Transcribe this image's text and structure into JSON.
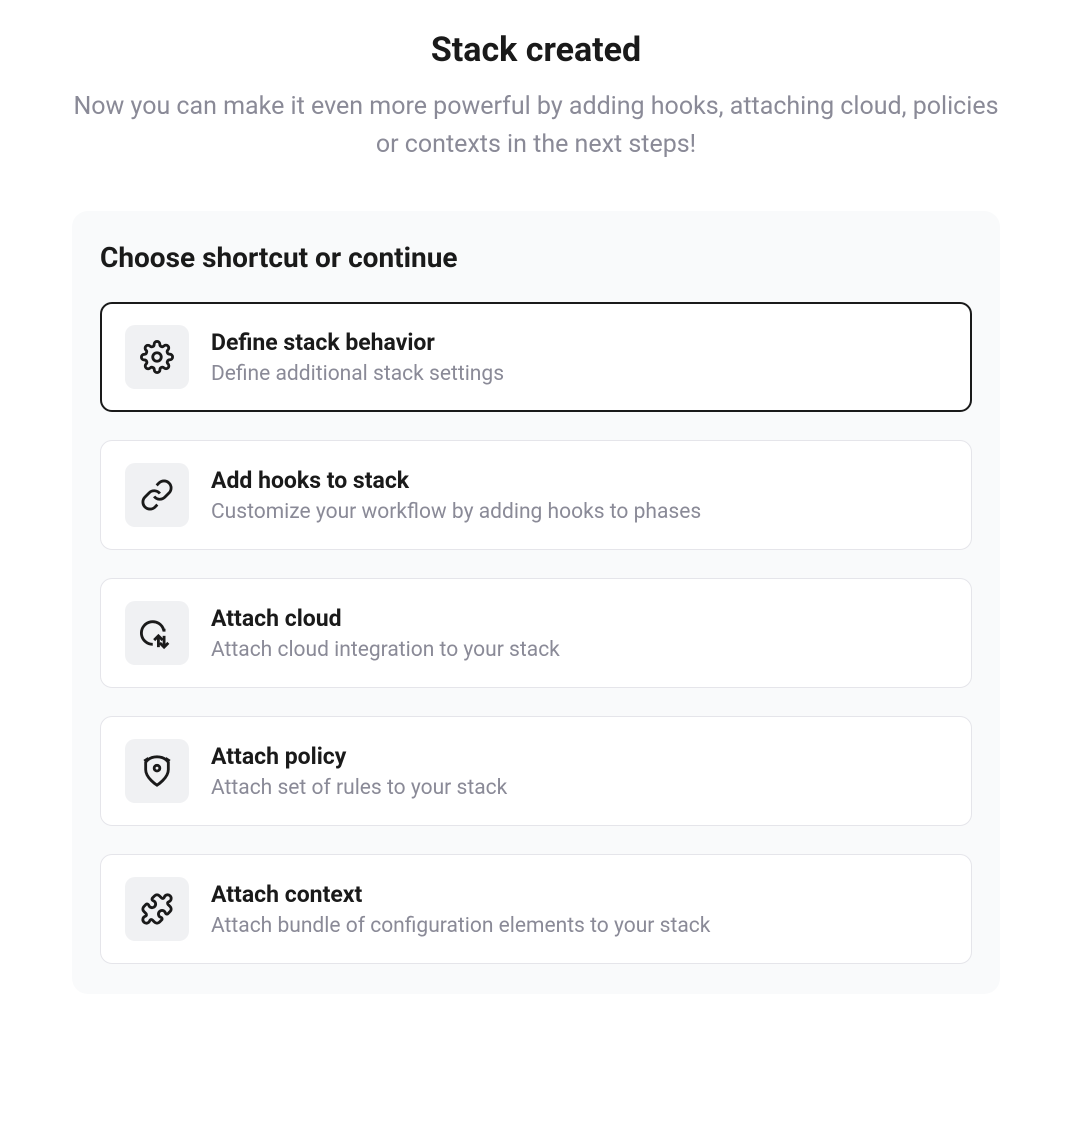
{
  "header": {
    "title": "Stack created",
    "subtitle": "Now you can make it even more powerful by adding hooks, attaching cloud, policies or contexts in the next steps!"
  },
  "card": {
    "title": "Choose shortcut or continue",
    "options": [
      {
        "icon": "gear",
        "title": "Define stack behavior",
        "desc": "Define additional stack settings",
        "selected": true
      },
      {
        "icon": "link",
        "title": "Add hooks to stack",
        "desc": "Customize your workflow by adding hooks to phases",
        "selected": false
      },
      {
        "icon": "cloud",
        "title": "Attach cloud",
        "desc": "Attach cloud integration to your stack",
        "selected": false
      },
      {
        "icon": "policy",
        "title": "Attach policy",
        "desc": "Attach set of rules to your stack",
        "selected": false
      },
      {
        "icon": "puzzle",
        "title": "Attach context",
        "desc": "Attach bundle of configuration elements to your stack",
        "selected": false
      }
    ]
  }
}
